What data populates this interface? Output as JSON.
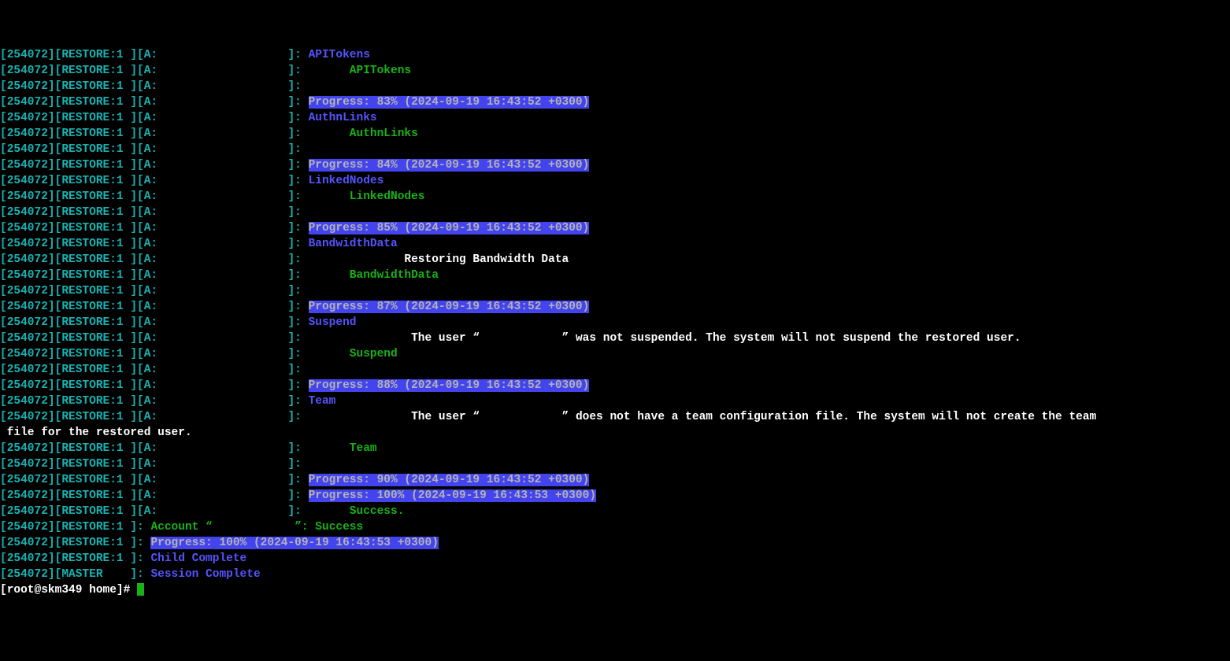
{
  "prefix": "[254072][RESTORE:1 ][A:",
  "close": "]:",
  "prefix2": "[254072][RESTORE:1 ]:",
  "prefix3": "[254072][MASTER    ]:",
  "prompt": "[root@skm349 home]# ",
  "wrapline": " file for the restored user.",
  "lines": {
    "apitokens1": "APITokens",
    "apitokens2": "APITokens",
    "prog83": "Progress: 83% (2024-09-19 16:43:52 +0300)",
    "authn1": "AuthnLinks",
    "authn2": "AuthnLinks",
    "prog84": "Progress: 84% (2024-09-19 16:43:52 +0300)",
    "linked1": "LinkedNodes",
    "linked2": "LinkedNodes",
    "prog85": "Progress: 85% (2024-09-19 16:43:52 +0300)",
    "bw1": "BandwidthData",
    "bwmsg": "Restoring Bandwidth Data",
    "bw2": "BandwidthData",
    "prog87": "Progress: 87% (2024-09-19 16:43:52 +0300)",
    "susp1": "Suspend",
    "suspmsg1": "The user “",
    "suspmsg2": "” was not suspended. The system will not suspend the restored user.",
    "susp2": "Suspend",
    "prog88": "Progress: 88% (2024-09-19 16:43:52 +0300)",
    "team1": "Team",
    "teammsg1": "The user “",
    "teammsg2": "” does not have a team configuration file. The system will not create the team",
    "team2": "Team",
    "prog90": "Progress: 90% (2024-09-19 16:43:52 +0300)",
    "prog100a": "Progress: 100% (2024-09-19 16:43:53 +0300)",
    "success": "Success.",
    "acct1": "Account “",
    "acct2": "”: Success",
    "prog100b": "Progress: 100% (2024-09-19 16:43:53 +0300)",
    "childc": "Child Complete",
    "sessc": "Session Complete"
  }
}
